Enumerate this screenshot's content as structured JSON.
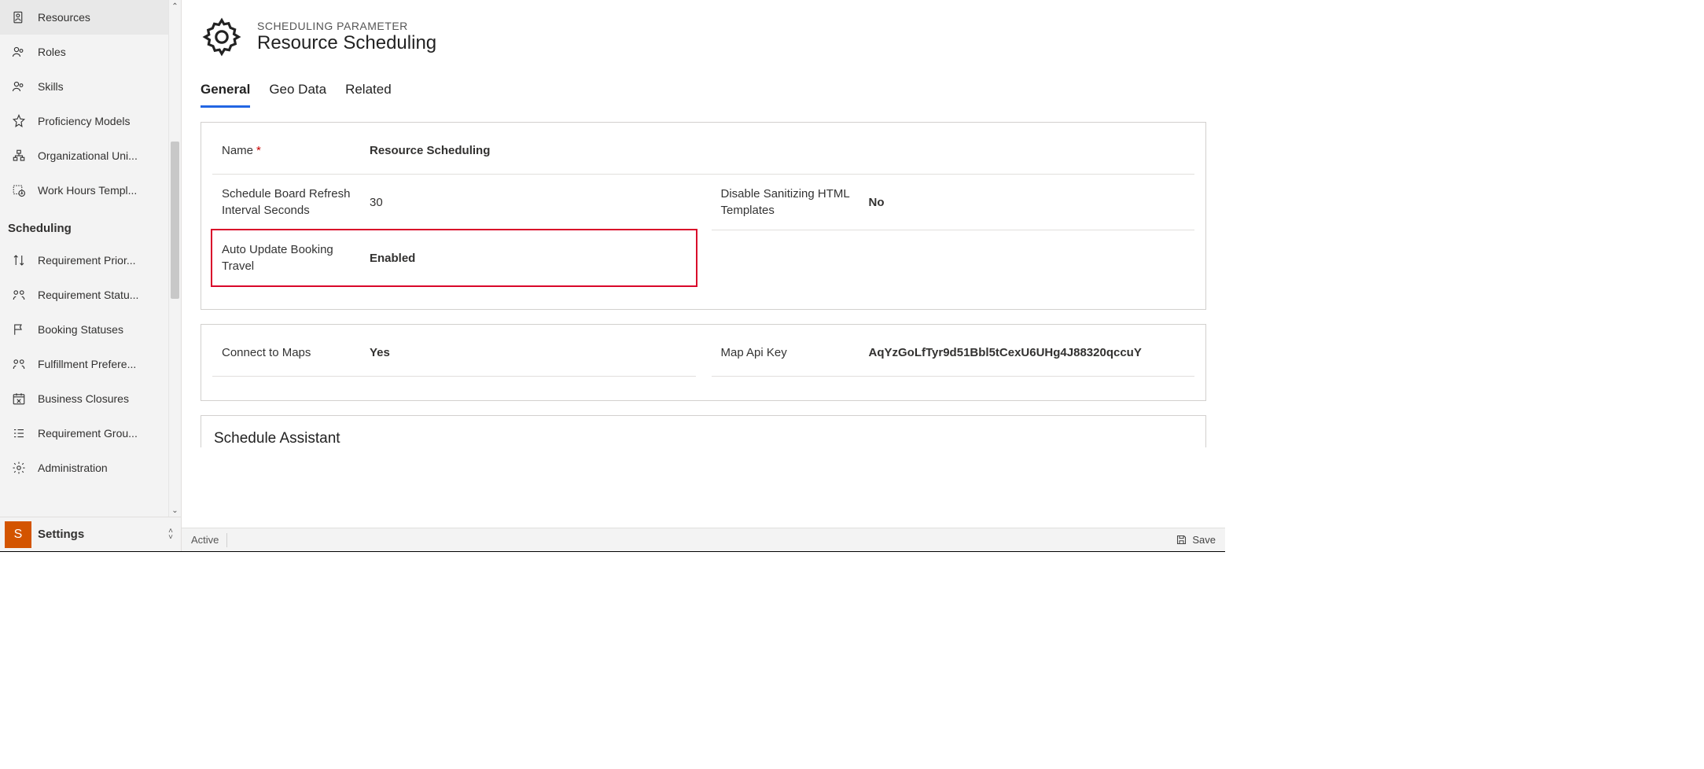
{
  "sidebar": {
    "items": [
      {
        "label": "Resources"
      },
      {
        "label": "Roles"
      },
      {
        "label": "Skills"
      },
      {
        "label": "Proficiency Models"
      },
      {
        "label": "Organizational Uni..."
      },
      {
        "label": "Work Hours Templ..."
      }
    ],
    "section_heading": "Scheduling",
    "scheduling_items": [
      {
        "label": "Requirement Prior..."
      },
      {
        "label": "Requirement Statu..."
      },
      {
        "label": "Booking Statuses"
      },
      {
        "label": "Fulfillment Prefere..."
      },
      {
        "label": "Business Closures"
      },
      {
        "label": "Requirement Grou..."
      },
      {
        "label": "Administration"
      }
    ]
  },
  "area": {
    "badge": "S",
    "label": "Settings"
  },
  "header": {
    "entity": "SCHEDULING PARAMETER",
    "title": "Resource Scheduling"
  },
  "tabs": [
    {
      "label": "General",
      "active": true
    },
    {
      "label": "Geo Data"
    },
    {
      "label": "Related"
    }
  ],
  "form": {
    "name_label": "Name",
    "name_value": "Resource Scheduling",
    "refresh_label": "Schedule Board Refresh Interval Seconds",
    "refresh_value": "30",
    "disable_html_label": "Disable Sanitizing HTML Templates",
    "disable_html_value": "No",
    "auto_update_label": "Auto Update Booking Travel",
    "auto_update_value": "Enabled",
    "connect_maps_label": "Connect to Maps",
    "connect_maps_value": "Yes",
    "map_key_label": "Map Api Key",
    "map_key_value": "AqYzGoLfTyr9d51Bbl5tCexU6UHg4J88320qccuY"
  },
  "section2_title": "Schedule Assistant",
  "status": {
    "state": "Active",
    "save": "Save"
  }
}
